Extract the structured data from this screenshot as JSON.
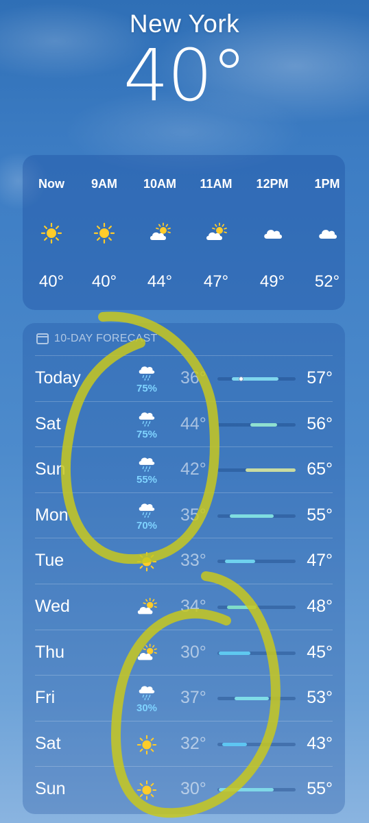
{
  "location": {
    "city": "New York",
    "temperature": "40°"
  },
  "hourly": [
    {
      "label": "Now",
      "icon": "sun-icon",
      "temp": "40°"
    },
    {
      "label": "9AM",
      "icon": "sun-icon",
      "temp": "40°"
    },
    {
      "label": "10AM",
      "icon": "partly-cloudy-icon",
      "temp": "44°"
    },
    {
      "label": "11AM",
      "icon": "partly-cloudy-icon",
      "temp": "47°"
    },
    {
      "label": "12PM",
      "icon": "cloud-icon",
      "temp": "49°"
    },
    {
      "label": "1PM",
      "icon": "cloud-icon",
      "temp": "52°"
    }
  ],
  "forecast": {
    "title": "10-DAY FORECAST",
    "days": [
      {
        "day": "Today",
        "icon": "rain-cloud-icon",
        "precip": "75%",
        "low": "36°",
        "high": "57°",
        "bar_start": 0.18,
        "bar_end": 0.78,
        "current_pos": 0.3,
        "bar_color": "#7fd6ee"
      },
      {
        "day": "Sat",
        "icon": "rain-cloud-icon",
        "precip": "75%",
        "low": "44°",
        "high": "56°",
        "bar_start": 0.42,
        "bar_end": 0.76,
        "bar_color": "#8fe0d0"
      },
      {
        "day": "Sun",
        "icon": "rain-cloud-icon",
        "precip": "55%",
        "low": "42°",
        "high": "65°",
        "bar_start": 0.36,
        "bar_end": 1.0,
        "bar_color": "#c9dba0"
      },
      {
        "day": "Mon",
        "icon": "rain-cloud-icon",
        "precip": "70%",
        "low": "35°",
        "high": "55°",
        "bar_start": 0.16,
        "bar_end": 0.72,
        "bar_color": "#7fdde0"
      },
      {
        "day": "Tue",
        "icon": "sun-icon",
        "precip": "",
        "low": "33°",
        "high": "47°",
        "bar_start": 0.1,
        "bar_end": 0.48,
        "bar_color": "#6fd2ee"
      },
      {
        "day": "Wed",
        "icon": "partly-cloudy-icon",
        "precip": "",
        "low": "34°",
        "high": "48°",
        "bar_start": 0.12,
        "bar_end": 0.5,
        "bar_color": "#7fdcc8"
      },
      {
        "day": "Thu",
        "icon": "partly-cloudy-icon",
        "precip": "",
        "low": "30°",
        "high": "45°",
        "bar_start": 0.02,
        "bar_end": 0.42,
        "bar_color": "#5fc8f0"
      },
      {
        "day": "Fri",
        "icon": "rain-cloud-icon",
        "precip": "30%",
        "low": "37°",
        "high": "53°",
        "bar_start": 0.22,
        "bar_end": 0.66,
        "bar_color": "#7fdce8"
      },
      {
        "day": "Sat",
        "icon": "sun-icon",
        "precip": "",
        "low": "32°",
        "high": "43°",
        "bar_start": 0.06,
        "bar_end": 0.38,
        "bar_color": "#5ec6f2"
      },
      {
        "day": "Sun",
        "icon": "sun-icon",
        "precip": "",
        "low": "30°",
        "high": "55°",
        "bar_start": 0.02,
        "bar_end": 0.72,
        "bar_color": "#7fd8e8"
      }
    ]
  },
  "colors": {
    "annotation": "#c8c81e",
    "precip": "#7fd3ff",
    "sun": "#ffcc2a"
  }
}
